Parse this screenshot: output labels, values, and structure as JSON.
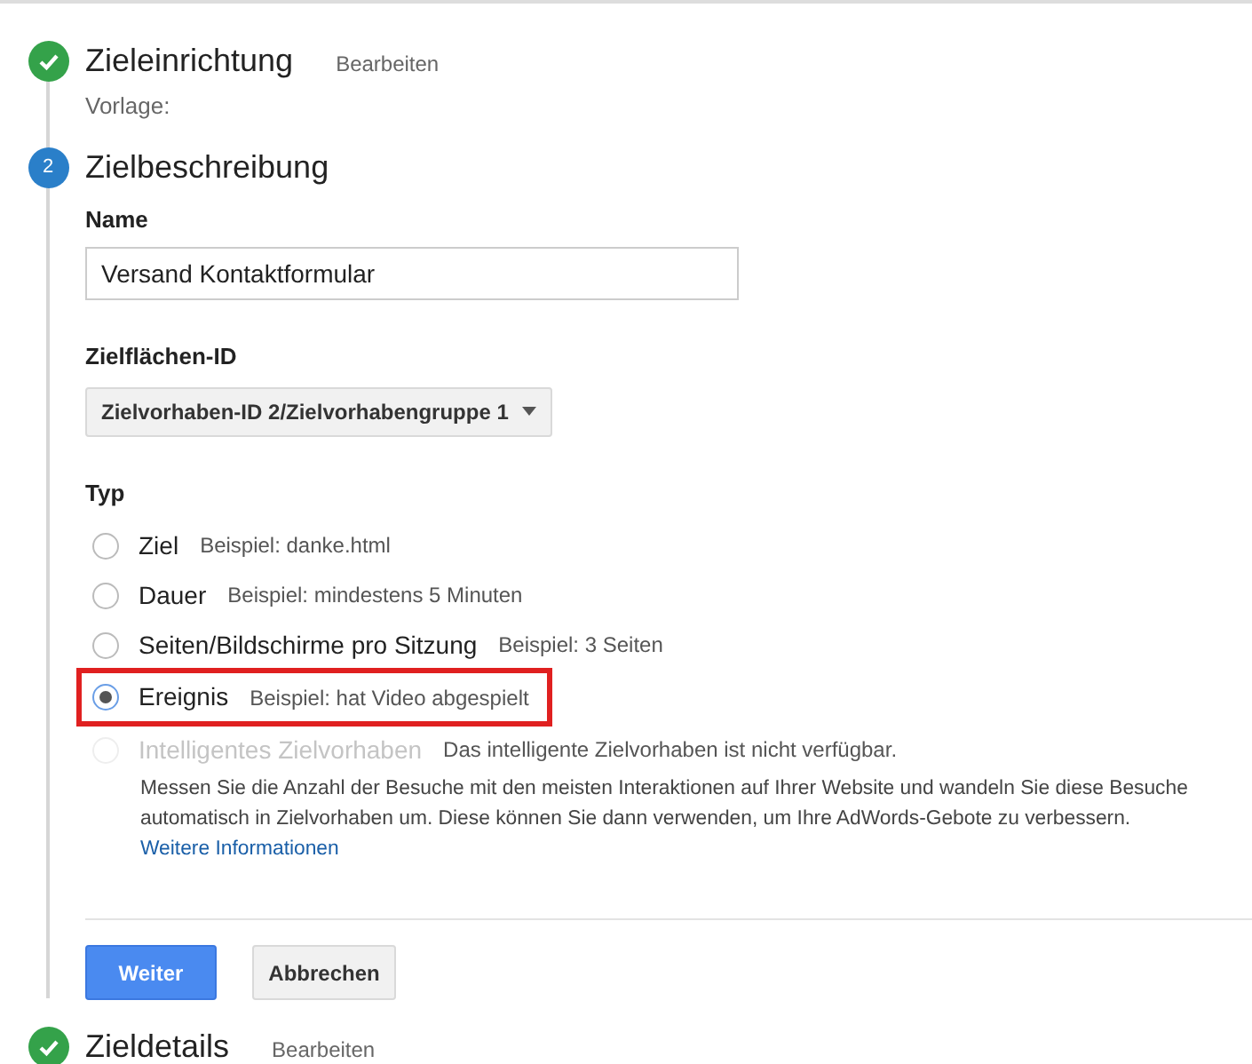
{
  "steps": [
    {
      "kind": "done",
      "title": "Zieleinrichtung",
      "action": "Bearbeiten",
      "subtitle": "Vorlage:"
    },
    {
      "kind": "active",
      "number": "2",
      "title": "Zielbeschreibung",
      "form": {
        "name_label": "Name",
        "name_value": "Versand Kontaktformular",
        "slot_label": "Zielflächen-ID",
        "slot_value": "Zielvorhaben-ID 2/Zielvorhabengruppe 1",
        "type_label": "Typ",
        "options": [
          {
            "label": "Ziel",
            "example": "Beispiel: danke.html",
            "selected": false,
            "disabled": false,
            "highlighted": false
          },
          {
            "label": "Dauer",
            "example": "Beispiel: mindestens 5 Minuten",
            "selected": false,
            "disabled": false,
            "highlighted": false
          },
          {
            "label": "Seiten/Bildschirme pro Sitzung",
            "example": "Beispiel: 3 Seiten",
            "selected": false,
            "disabled": false,
            "highlighted": false
          },
          {
            "label": "Ereignis",
            "example": "Beispiel: hat Video abgespielt",
            "selected": true,
            "disabled": false,
            "highlighted": true
          },
          {
            "label": "Intelligentes Zielvorhaben",
            "example": "Das intelligente Zielvorhaben ist nicht verfügbar.",
            "selected": false,
            "disabled": true,
            "highlighted": false,
            "description": "Messen Sie die Anzahl der Besuche mit den meisten Interaktionen auf Ihrer Website und wandeln Sie diese Besuche automatisch in Zielvorhaben um. Diese können Sie dann verwenden, um Ihre AdWords-Gebote zu verbessern.",
            "link": "Weitere Informationen"
          }
        ],
        "buttons": [
          {
            "label": "Weiter",
            "kind": "primary"
          },
          {
            "label": "Abbrechen",
            "kind": "secondary"
          }
        ]
      }
    },
    {
      "kind": "done",
      "title": "Zieldetails",
      "action": "Bearbeiten"
    }
  ]
}
